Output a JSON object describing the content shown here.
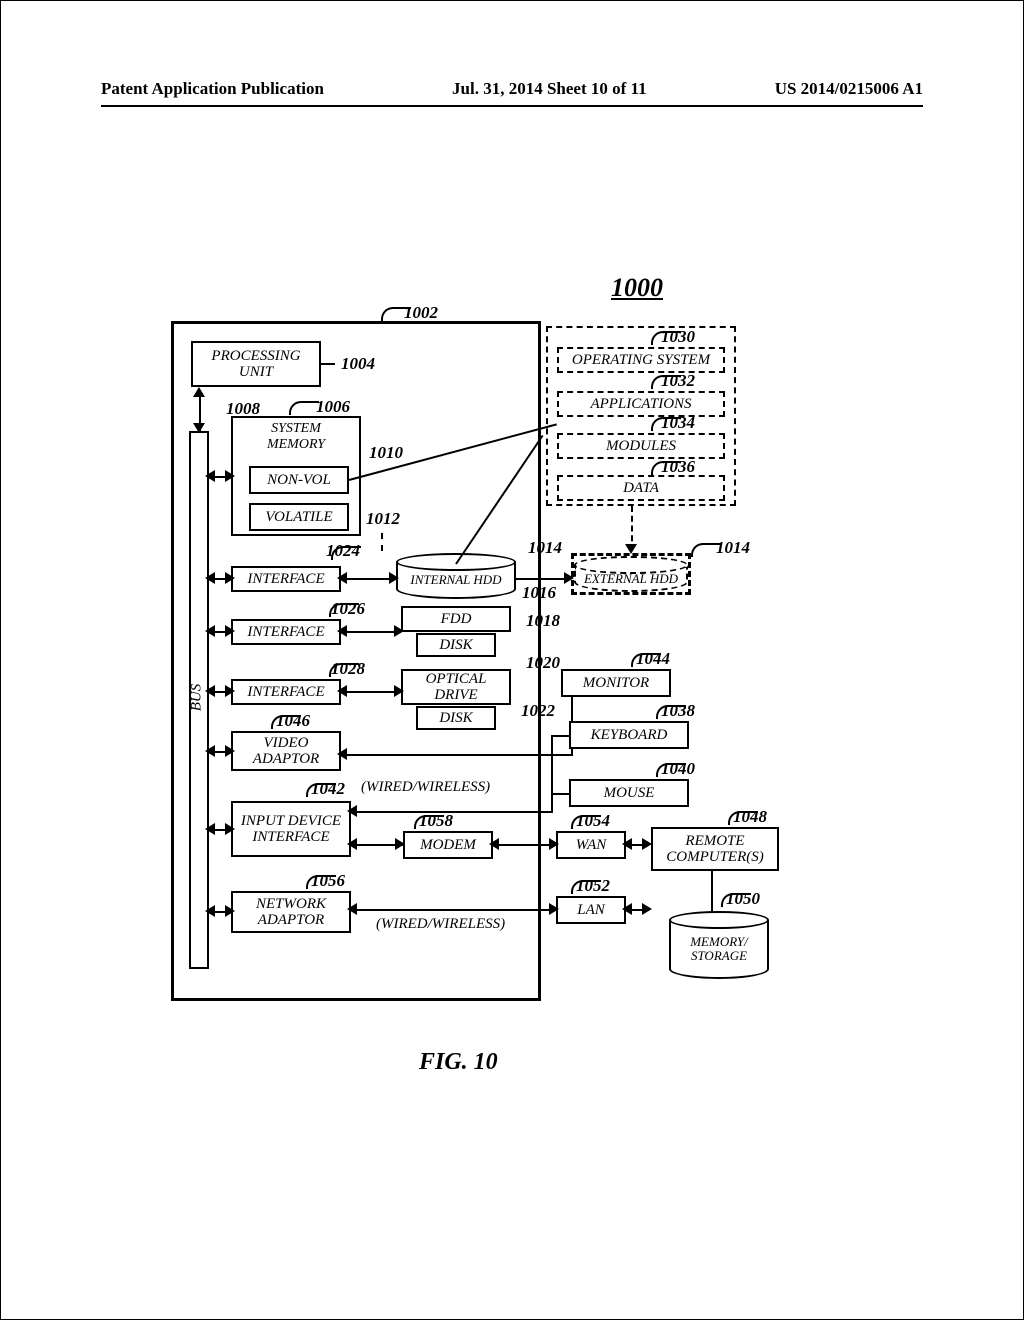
{
  "header": {
    "left": "Patent Application Publication",
    "center": "Jul. 31, 2014  Sheet 10 of 11",
    "right": "US 2014/0215006 A1"
  },
  "figure": {
    "main_ref": "1000",
    "caption": "FIG. 10"
  },
  "labels": {
    "bus": "BUS",
    "processing_unit": "PROCESSING UNIT",
    "system_memory": "SYSTEM MEMORY",
    "non_vol": "NON-VOL",
    "volatile": "VOLATILE",
    "interface_1": "INTERFACE",
    "interface_2": "INTERFACE",
    "interface_3": "INTERFACE",
    "video_adaptor": "VIDEO ADAPTOR",
    "input_device_interface": "INPUT DEVICE INTERFACE",
    "network_adaptor": "NETWORK ADAPTOR",
    "internal_hdd": "INTERNAL HDD",
    "external_hdd": "EXTERNAL HDD",
    "fdd": "FDD",
    "disk_1": "DISK",
    "optical_drive": "OPTICAL DRIVE",
    "disk_2": "DISK",
    "monitor": "MONITOR",
    "keyboard": "KEYBOARD",
    "mouse": "MOUSE",
    "modem": "MODEM",
    "wan": "WAN",
    "lan": "LAN",
    "remote_computers": "REMOTE COMPUTER(S)",
    "memory_storage": "MEMORY/ STORAGE",
    "operating_system": "OPERATING SYSTEM",
    "applications": "APPLICATIONS",
    "modules": "MODULES",
    "data": "DATA",
    "wired_wireless": "(WIRED/WIRELESS)"
  },
  "refs": {
    "1002": "1002",
    "1004": "1004",
    "1006": "1006",
    "1008": "1008",
    "1010": "1010",
    "1012": "1012",
    "1014": "1014",
    "1014b": "1014",
    "1016": "1016",
    "1018": "1018",
    "1020": "1020",
    "1022": "1022",
    "1024": "1024",
    "1026": "1026",
    "1028": "1028",
    "1030": "1030",
    "1032": "1032",
    "1034": "1034",
    "1036": "1036",
    "1038": "1038",
    "1040": "1040",
    "1042": "1042",
    "1044": "1044",
    "1046": "1046",
    "1048": "1048",
    "1050": "1050",
    "1052": "1052",
    "1054": "1054",
    "1056": "1056",
    "1058": "1058"
  }
}
